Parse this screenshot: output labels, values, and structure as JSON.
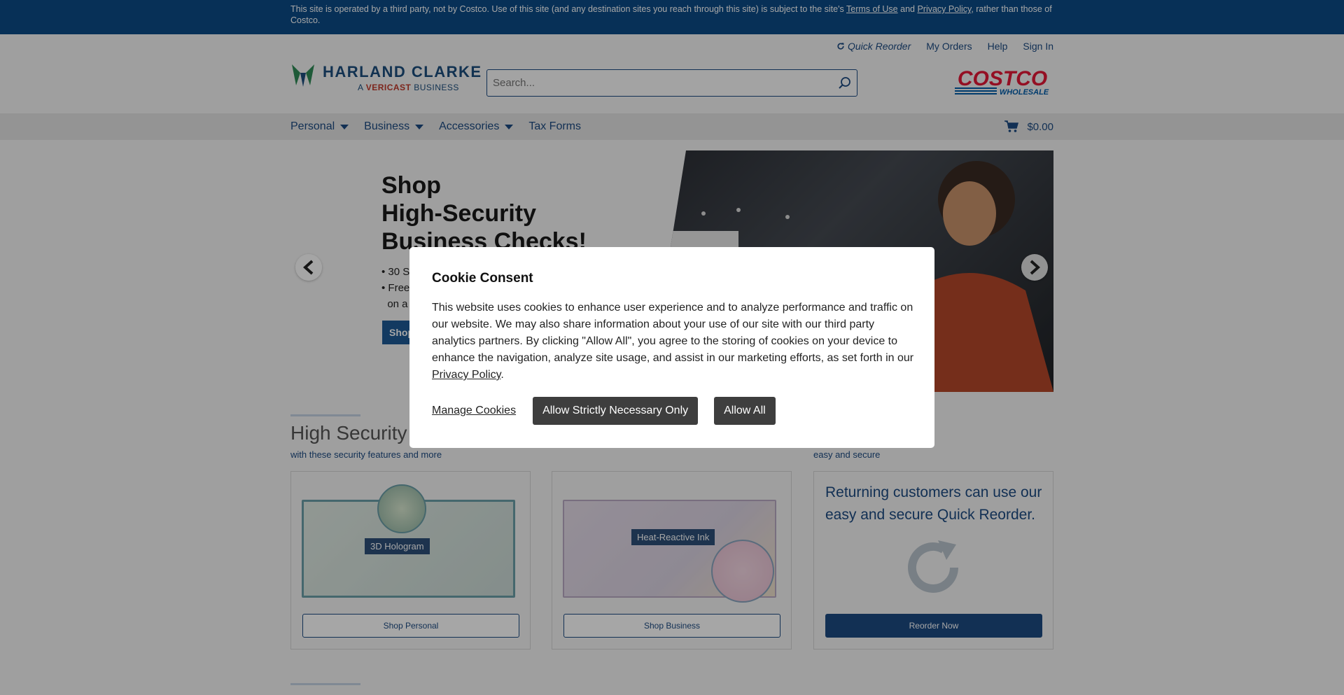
{
  "notice": {
    "text_before": "This site is operated by a third party, not by Costco. Use of this site (and any destination sites you reach through this site) is subject to the site's ",
    "terms_link": "Terms of Use",
    "and": " and ",
    "privacy_link": "Privacy Policy",
    "text_after": ", rather than those of Costco."
  },
  "utility": {
    "quick_reorder": "Quick Reorder",
    "my_orders": "My Orders",
    "help": "Help",
    "sign_in": "Sign In"
  },
  "logo": {
    "name": "HARLAND CLARKE",
    "sub_prefix": "A ",
    "sub_brand": "VERICAST",
    "sub_suffix": " BUSINESS"
  },
  "search": {
    "placeholder": "Search..."
  },
  "costco_logo": {
    "line1": "COSTCO",
    "line2": "WHOLESALE"
  },
  "nav": {
    "items": [
      {
        "label": "Personal"
      },
      {
        "label": "Business"
      },
      {
        "label": "Accessories"
      },
      {
        "label": "Tax Forms"
      }
    ],
    "cart_total": "$0.00"
  },
  "hero": {
    "title_line1": "Shop",
    "title_line2": "High-Security",
    "title_line3": "Business Checks!",
    "bullet1": "• 30 S",
    "bullet2": "• Free",
    "bullet3": "  on a",
    "cta": "Shop"
  },
  "sections": {
    "title": "High Security",
    "sub_left": "with these security features and more",
    "sub_right": "easy and secure"
  },
  "cards": {
    "personal": {
      "tag": "3D Hologram",
      "button": "Shop Personal"
    },
    "business": {
      "tag": "Heat-Reactive Ink",
      "button": "Shop Business"
    },
    "reorder": {
      "text": "Returning customers can use our easy and secure Quick Reorder.",
      "button": "Reorder Now"
    }
  },
  "cookie_modal": {
    "title": "Cookie Consent",
    "body": "This website uses cookies to enhance user experience and to analyze performance and traffic on our website. We may also share information about your use of our site with our third party analytics partners. By clicking \"Allow All\", you agree to the storing of cookies on your device to enhance the navigation, analyze site usage, and assist in our marketing efforts, as set forth in our ",
    "privacy_link": "Privacy Policy",
    "body_end": ".",
    "manage": "Manage Cookies",
    "strict": "Allow Strictly Necessary Only",
    "allow_all": "Allow All"
  },
  "colors": {
    "notice_bg": "#0c4a86",
    "brand_blue": "#1c4a82",
    "costco_red": "#e31837",
    "costco_blue": "#005daa",
    "button_dark": "#3e3e3e"
  }
}
